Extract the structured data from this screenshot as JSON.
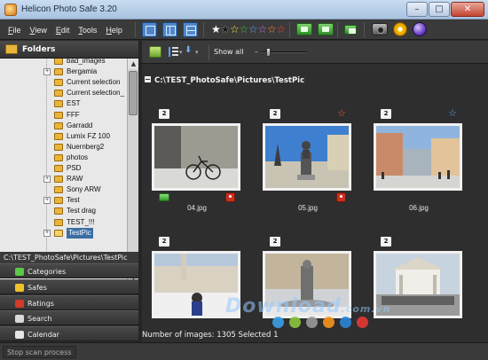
{
  "window": {
    "title": "Helicon Photo Safe 3.20",
    "minimize": "–",
    "maximize": "□",
    "close": "✕"
  },
  "menu": {
    "items": [
      {
        "label": "File",
        "key": "F",
        "rest": "ile"
      },
      {
        "label": "View",
        "key": "V",
        "rest": "iew"
      },
      {
        "label": "Edit",
        "key": "E",
        "rest": "dit"
      },
      {
        "label": "Tools",
        "key": "T",
        "rest": "ools"
      },
      {
        "label": "Help",
        "key": "H",
        "rest": "elp"
      }
    ]
  },
  "toolbar": {
    "star_filled": "★",
    "star_empty": "☆",
    "rating_star_colors": [
      "#ffffff",
      "#1a1a1a",
      "#f2e14a",
      "#3fc63f",
      "#5aa7ff",
      "#c474ff",
      "#ff8a3a",
      "#ff3b3b"
    ]
  },
  "folders": {
    "header": "Folders",
    "items": [
      {
        "name": "bad_images",
        "expandable": false
      },
      {
        "name": "Bergamia",
        "expandable": true
      },
      {
        "name": "Current selection",
        "expandable": false
      },
      {
        "name": "Current selection_",
        "expandable": false
      },
      {
        "name": "EST",
        "expandable": false
      },
      {
        "name": "FFF",
        "expandable": false
      },
      {
        "name": "Garradd",
        "expandable": false
      },
      {
        "name": "Lumix FZ 100",
        "expandable": false
      },
      {
        "name": "Nuernberg2",
        "expandable": false
      },
      {
        "name": "photos",
        "expandable": false
      },
      {
        "name": "PSD",
        "expandable": false
      },
      {
        "name": "RAW",
        "expandable": true
      },
      {
        "name": "Sony ARW",
        "expandable": false
      },
      {
        "name": "Test",
        "expandable": true
      },
      {
        "name": "Test drag",
        "expandable": false
      },
      {
        "name": "TEST_!!!",
        "expandable": false
      },
      {
        "name": "TestPic",
        "expandable": true,
        "selected": true
      }
    ],
    "expand_glyph": "+"
  },
  "path_bar": "C:\\TEST_PhotoSafe\\Pictures\\TestPic",
  "nav_sections": [
    {
      "label": "Categories",
      "icon_color": "#5cc84a"
    },
    {
      "label": "Safes",
      "icon_color": "#f0c22a"
    },
    {
      "label": "Ratings",
      "icon_color": "#d23a2a"
    },
    {
      "label": "Search",
      "icon_color": "#d9d9d9"
    },
    {
      "label": "Calendar",
      "icon_color": "#e6e6e6"
    }
  ],
  "stop_scan": "Stop scan process",
  "panel_toolbar": {
    "show_all": "Show all",
    "dropdown_glyph": "▾",
    "minus": "–",
    "zoom_level": 0.1
  },
  "content": {
    "path": "C:\\TEST_PhotoSafe\\Pictures\\TestPic",
    "thumbnails": [
      {
        "file": "04.jpg",
        "badge": "2",
        "star_color": "",
        "tag": true,
        "pin": true
      },
      {
        "file": "05.jpg",
        "badge": "2",
        "star_color": "#ff5a3a",
        "tag": false,
        "pin": true
      },
      {
        "file": "06.jpg",
        "badge": "2",
        "star_color": "#5aa7ff",
        "tag": false,
        "pin": false
      },
      {
        "file": "",
        "badge": "2",
        "star_color": "",
        "tag": false,
        "pin": false
      },
      {
        "file": "",
        "badge": "2",
        "star_color": "",
        "tag": false,
        "pin": false
      },
      {
        "file": "",
        "badge": "2",
        "star_color": "",
        "tag": false,
        "pin": false
      }
    ]
  },
  "status": "Number of images: 1305 Selected 1",
  "watermark": {
    "brand": "Download",
    "suffix": ".com.vn",
    "dot_colors": [
      "#3aa0e8",
      "#8cc63f",
      "#9a9a9a",
      "#f7931e",
      "#2a86d6",
      "#e53935"
    ]
  }
}
